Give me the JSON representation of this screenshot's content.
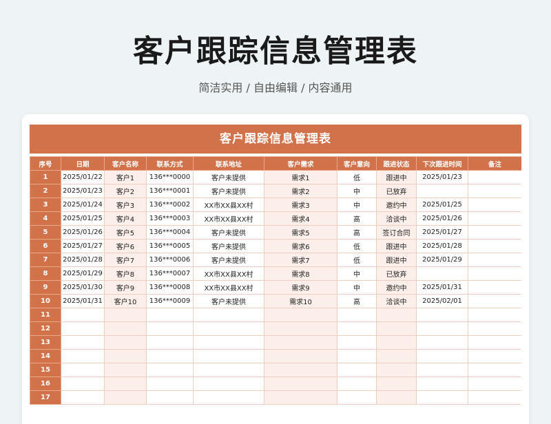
{
  "page": {
    "title": "客户跟踪信息管理表",
    "subtitle": "简洁实用 / 自由编辑 / 内容通用"
  },
  "sheet": {
    "banner": "客户跟踪信息管理表",
    "columns": [
      "序号",
      "日期",
      "客户名称",
      "联系方式",
      "联系地址",
      "客户需求",
      "客户意向",
      "跟进状态",
      "下次跟进时间",
      "备注"
    ],
    "rows": [
      [
        "1",
        "2025/01/22",
        "客户1",
        "136***0000",
        "客户未提供",
        "需求1",
        "低",
        "跟进中",
        "2025/01/23",
        ""
      ],
      [
        "2",
        "2025/01/23",
        "客户2",
        "136***0001",
        "客户未提供",
        "需求2",
        "中",
        "已放弃",
        "",
        ""
      ],
      [
        "3",
        "2025/01/24",
        "客户3",
        "136***0002",
        "XX市XX县XX村",
        "需求3",
        "中",
        "邀约中",
        "2025/01/25",
        ""
      ],
      [
        "4",
        "2025/01/25",
        "客户4",
        "136***0003",
        "XX市XX县XX村",
        "需求4",
        "高",
        "洽谈中",
        "2025/01/26",
        ""
      ],
      [
        "5",
        "2025/01/26",
        "客户5",
        "136***0004",
        "客户未提供",
        "需求5",
        "高",
        "签订合同",
        "2025/01/27",
        ""
      ],
      [
        "6",
        "2025/01/27",
        "客户6",
        "136***0005",
        "客户未提供",
        "需求6",
        "低",
        "跟进中",
        "2025/01/28",
        ""
      ],
      [
        "7",
        "2025/01/28",
        "客户7",
        "136***0006",
        "客户未提供",
        "需求7",
        "低",
        "跟进中",
        "2025/01/29",
        ""
      ],
      [
        "8",
        "2025/01/29",
        "客户8",
        "136***0007",
        "XX市XX县XX村",
        "需求8",
        "中",
        "已放弃",
        "",
        ""
      ],
      [
        "9",
        "2025/01/30",
        "客户9",
        "136***0008",
        "XX市XX县XX村",
        "需求9",
        "中",
        "邀约中",
        "2025/01/31",
        ""
      ],
      [
        "10",
        "2025/01/31",
        "客户10",
        "136***0009",
        "客户未提供",
        "需求10",
        "高",
        "洽谈中",
        "2025/02/01",
        ""
      ],
      [
        "11",
        "",
        "",
        "",
        "",
        "",
        "",
        "",
        "",
        ""
      ],
      [
        "12",
        "",
        "",
        "",
        "",
        "",
        "",
        "",
        "",
        ""
      ],
      [
        "13",
        "",
        "",
        "",
        "",
        "",
        "",
        "",
        "",
        ""
      ],
      [
        "14",
        "",
        "",
        "",
        "",
        "",
        "",
        "",
        "",
        ""
      ],
      [
        "15",
        "",
        "",
        "",
        "",
        "",
        "",
        "",
        "",
        ""
      ],
      [
        "16",
        "",
        "",
        "",
        "",
        "",
        "",
        "",
        "",
        ""
      ],
      [
        "17",
        "",
        "",
        "",
        "",
        "",
        "",
        "",
        "",
        ""
      ]
    ]
  },
  "colors": {
    "accent": "#d2724a",
    "stripe": "#fcefe9",
    "background": "#eef4f5"
  }
}
